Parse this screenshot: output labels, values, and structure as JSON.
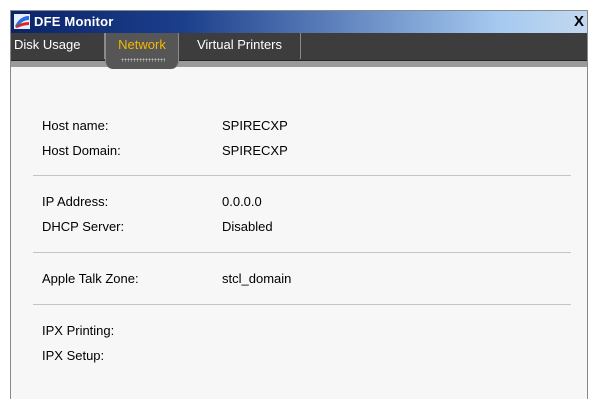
{
  "window": {
    "title": "DFE Monitor",
    "close_label": "X"
  },
  "tabs": [
    {
      "label": "Disk Usage"
    },
    {
      "label": "Network"
    },
    {
      "label": "Virtual Printers"
    }
  ],
  "network": {
    "host_name_label": "Host name:",
    "host_name_value": "SPIRECXP",
    "host_domain_label": "Host Domain:",
    "host_domain_value": "SPIRECXP",
    "ip_address_label": "IP Address:",
    "ip_address_value": "0.0.0.0",
    "dhcp_label": "DHCP Server:",
    "dhcp_value": "Disabled",
    "appletalk_label": "Apple Talk Zone:",
    "appletalk_value": "stcl_domain",
    "ipx_printing_label": "IPX Printing:",
    "ipx_setup_label": "IPX Setup:"
  },
  "colors": {
    "active_tab_text": "#f5b800",
    "tabbar": "#3d3d3d",
    "title_gradient_start": "#0a246a"
  }
}
